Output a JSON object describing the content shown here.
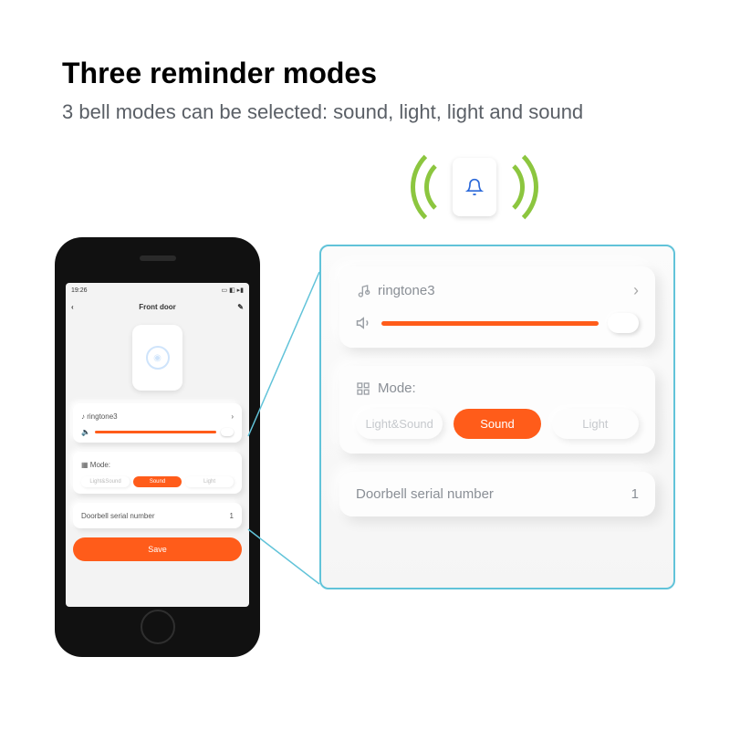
{
  "heading": "Three reminder modes",
  "subheading": "3 bell modes can be selected: sound, light, light and sound",
  "colors": {
    "accent": "#ff5c1a",
    "panel_border": "#61c3d9",
    "wave": "#8cc63f",
    "bell": "#2a68d9"
  },
  "phone": {
    "status_time": "19:26",
    "title": "Front door",
    "ringtone_card": {
      "name": "ringtone3"
    },
    "mode_card": {
      "label": "Mode:",
      "options": [
        "Light&Sound",
        "Sound",
        "Light"
      ],
      "selected": "Sound"
    },
    "serial_card": {
      "label": "Doorbell serial number",
      "value": "1"
    },
    "save_label": "Save"
  },
  "zoom": {
    "ringtone": {
      "name": "ringtone3"
    },
    "mode": {
      "label": "Mode:",
      "options": [
        "Light&Sound",
        "Sound",
        "Light"
      ],
      "selected": "Sound"
    },
    "serial": {
      "label": "Doorbell serial number",
      "value": "1"
    }
  }
}
